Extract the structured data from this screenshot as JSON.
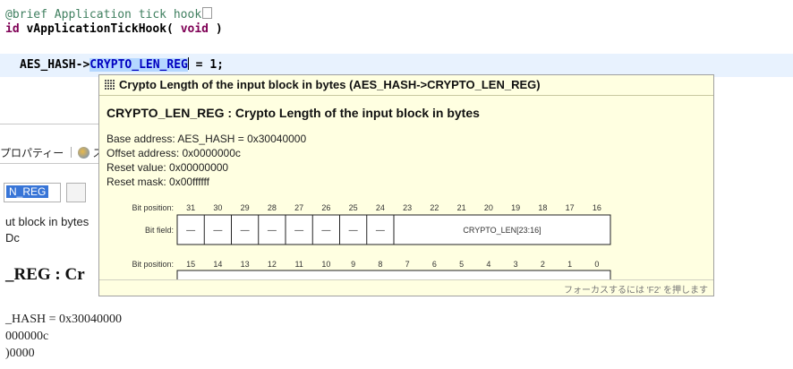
{
  "editor": {
    "comment_line": "@brief Application tick hook",
    "func_prefix": "id ",
    "func_name": "vApplicationTickHook(",
    "func_kw": "void",
    "func_close": " )",
    "code_prefix": "AES_HASH->",
    "code_highlight": "CRYPTO_LEN_REG",
    "code_suffix": " = 1;"
  },
  "background_panel": {
    "tab_label": "プロパティー",
    "tab2_label": "ス",
    "search_value": "N_REG",
    "desc_line1": "ut block in bytes",
    "desc_line2": "Dc",
    "heading": "_REG : Cr",
    "addr_line1": "_HASH = 0x30040000",
    "addr_line2": "000000c",
    "addr_line3": ")0000"
  },
  "popup": {
    "title": "Crypto Length of the input block in bytes (AES_HASH->CRYPTO_LEN_REG)",
    "heading": "CRYPTO_LEN_REG : Crypto Length of the input block in bytes",
    "base_address": "Base address: AES_HASH = 0x30040000",
    "offset_address": "Offset address: 0x0000000c",
    "reset_value": "Reset value: 0x00000000",
    "reset_mask": "Reset mask: 0x00ffffff",
    "bit_position_label": "Bit position:",
    "bit_field_label": "Bit field:",
    "upper_bits": [
      "31",
      "30",
      "29",
      "28",
      "27",
      "26",
      "25",
      "24",
      "23",
      "22",
      "21",
      "20",
      "19",
      "18",
      "17",
      "16"
    ],
    "upper_fields": [
      "—",
      "—",
      "—",
      "—",
      "—",
      "—",
      "—",
      "—"
    ],
    "upper_wide_field": "CRYPTO_LEN[23:16]",
    "lower_bits": [
      "15",
      "14",
      "13",
      "12",
      "11",
      "10",
      "9",
      "8",
      "7",
      "6",
      "5",
      "4",
      "3",
      "2",
      "1",
      "0"
    ],
    "status_hint": "フォーカスするには 'F2' を押します"
  },
  "colors": {
    "popup_bg": "#ffffe1",
    "highlight_bg": "#b4d7ff",
    "keyword": "#7f0055",
    "comment": "#3f7f5f"
  }
}
